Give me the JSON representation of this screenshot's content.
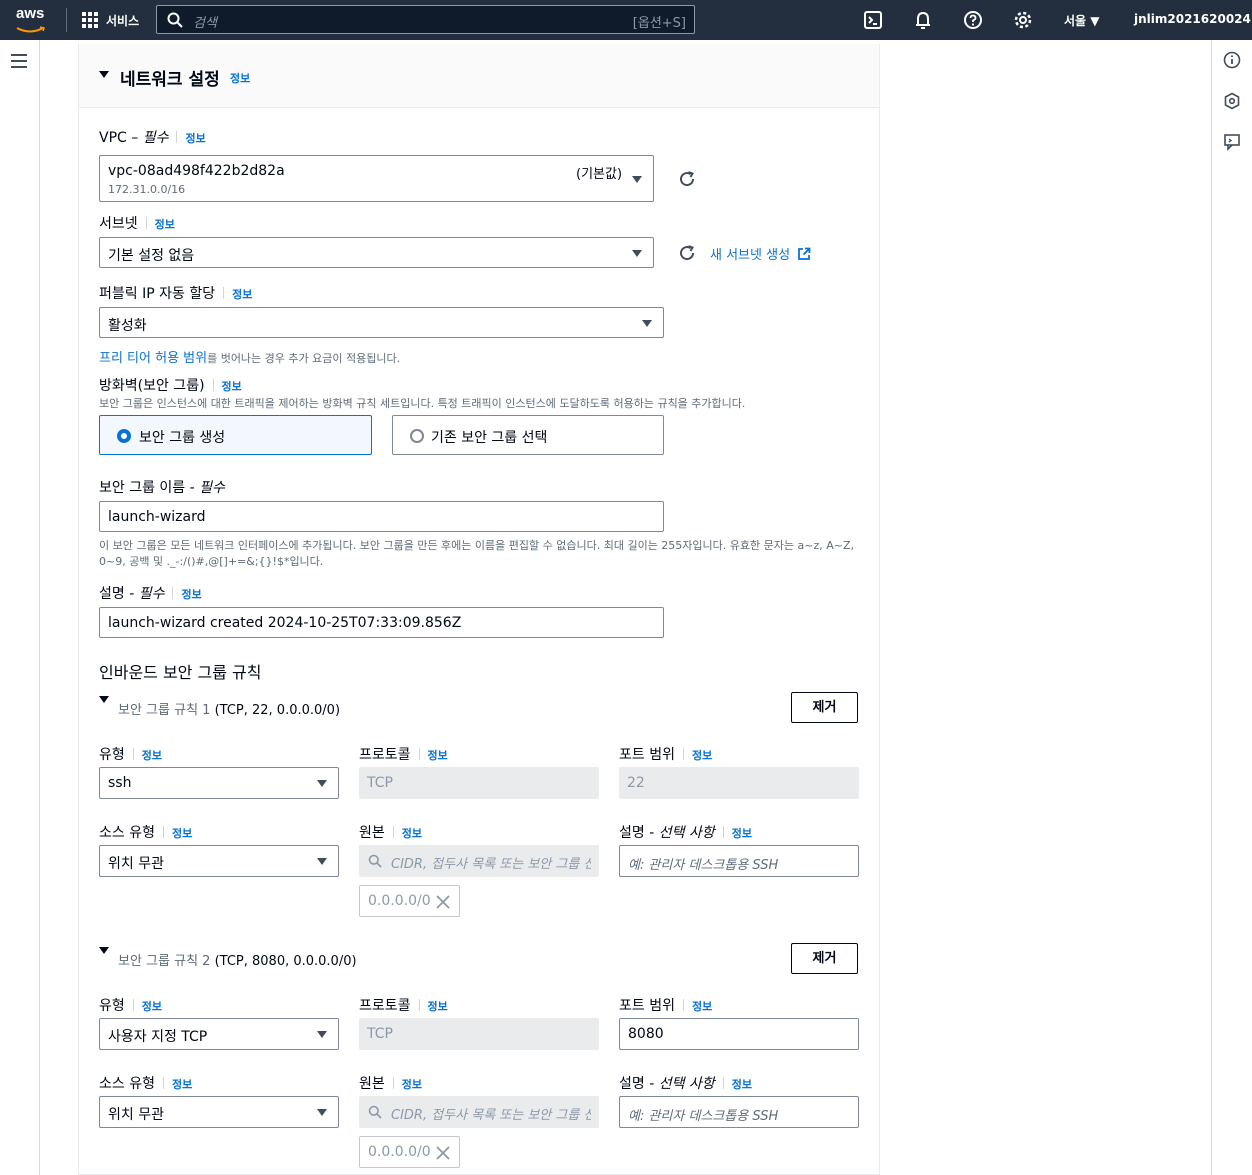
{
  "topnav": {
    "logo_text": "aws",
    "services_label": "서비스",
    "search_placeholder": "검색",
    "search_hint": "[옵션+S]",
    "region": "서울",
    "user": "jnlim2021620024"
  },
  "network": {
    "title": "네트워크 설정",
    "info": "정보",
    "vpc": {
      "label": "VPC –",
      "required": "필수",
      "info": "정보",
      "value": "vpc-08ad498f422b2d82a",
      "cidr": "172.31.0.0/16",
      "default_tag": "(기본값)"
    },
    "subnet": {
      "label": "서브넷",
      "info": "정보",
      "value": "기본 설정 없음",
      "new_subnet_link": "새 서브넷 생성"
    },
    "public_ip": {
      "label": "퍼블릭 IP 자동 할당",
      "info": "정보",
      "value": "활성화",
      "note_link": "프리 티어 허용 범위",
      "note_text": "를 벗어나는 경우 추가 요금이 적용됩니다."
    },
    "firewall": {
      "label": "방화벽(보안 그룹)",
      "info": "정보",
      "description": "보안 그룹은 인스턴스에 대한 트래픽을 제어하는 방화벽 규칙 세트입니다. 특정 트래픽이 인스턴스에 도달하도록 허용하는 규칙을 추가합니다.",
      "option_create": "보안 그룹 생성",
      "option_existing": "기존 보안 그룹 선택"
    },
    "sg_name": {
      "label": "보안 그룹 이름 -",
      "required": "필수",
      "value": "launch-wizard",
      "help_line1": "이 보안 그룹은 모든 네트워크 인터페이스에 추가됩니다. 보안 그룹을 만든 후에는 이름을 편집할 수 없습니다. 최대 길이는 255자입니다. 유효한 문자는 a~z, A~Z,",
      "help_line2": "0~9, 공백 및 ._-:/()#,@[]+=&;{}!$*입니다."
    },
    "description": {
      "label": "설명 -",
      "required": "필수",
      "info": "정보",
      "value": "launch-wizard created 2024-10-25T07:33:09.856Z"
    },
    "inbound": {
      "title": "인바운드 보안 그룹 규칙",
      "rules": [
        {
          "header_prefix": "보안 그룹 규칙 1",
          "header_detail": " (TCP, 22, 0.0.0.0/0)",
          "remove": "제거",
          "type_label": "유형",
          "type_info": "정보",
          "type_value": "ssh",
          "protocol_label": "프로토콜",
          "protocol_info": "정보",
          "protocol_value": "TCP",
          "port_label": "포트 범위",
          "port_info": "정보",
          "port_value": "22",
          "source_type_label": "소스 유형",
          "source_type_info": "정보",
          "source_type_value": "위치 무관",
          "source_label": "원본",
          "source_info": "정보",
          "source_placeholder": "CIDR, 접두사 목록 또는 보안 그룹 선택",
          "source_token": "0.0.0.0/0",
          "desc_label": "설명 -",
          "desc_optional": "선택 사항",
          "desc_info": "정보",
          "desc_placeholder": "예: 관리자 데스크톱용 SSH"
        },
        {
          "header_prefix": "보안 그룹 규칙 2",
          "header_detail": " (TCP, 8080, 0.0.0.0/0)",
          "remove": "제거",
          "type_label": "유형",
          "type_info": "정보",
          "type_value": "사용자 지정 TCP",
          "protocol_label": "프로토콜",
          "protocol_info": "정보",
          "protocol_value": "TCP",
          "port_label": "포트 범위",
          "port_info": "정보",
          "port_value": "8080",
          "source_type_label": "소스 유형",
          "source_type_info": "정보",
          "source_type_value": "위치 무관",
          "source_label": "원본",
          "source_info": "정보",
          "source_placeholder": "CIDR, 접두사 목록 또는 보안 그룹 선택",
          "source_token": "0.0.0.0/0",
          "desc_label": "설명 -",
          "desc_optional": "선택 사항",
          "desc_info": "정보",
          "desc_placeholder": "예: 관리자 데스크톱용 SSH"
        }
      ]
    }
  }
}
